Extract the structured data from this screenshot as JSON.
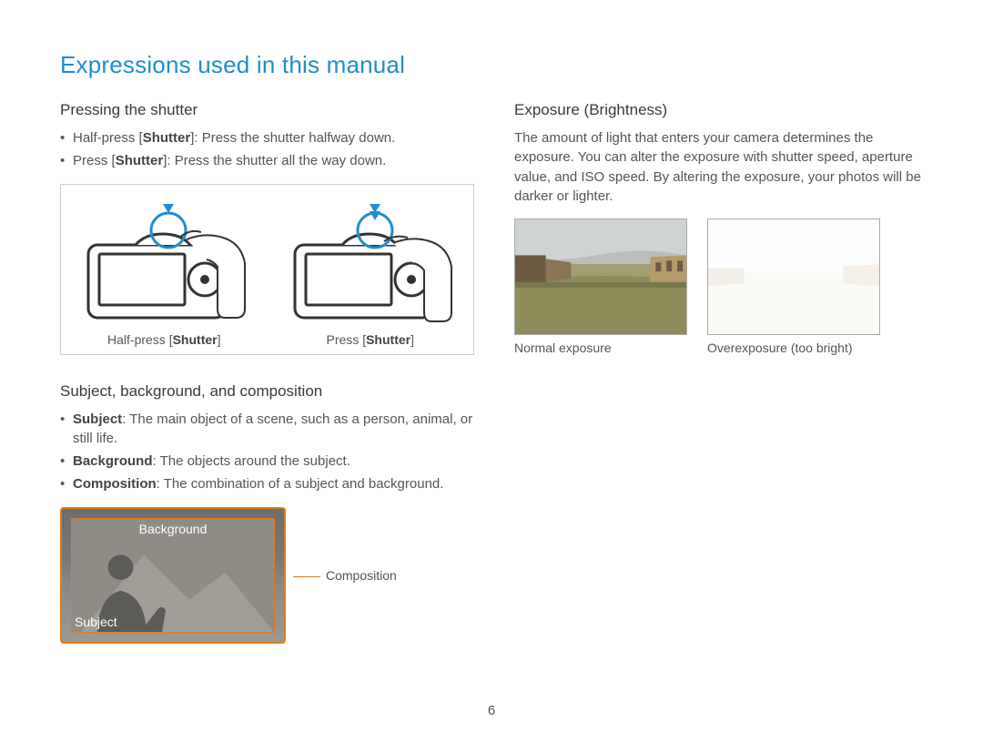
{
  "page_title": "Expressions used in this manual",
  "page_number": "6",
  "left": {
    "pressing": {
      "heading": "Pressing the shutter",
      "bullets": [
        {
          "prefix": "Half-press [",
          "bold": "Shutter",
          "suffix": "]: Press the shutter halfway down."
        },
        {
          "prefix": "Press [",
          "bold": "Shutter",
          "suffix": "]: Press the shutter all the way down."
        }
      ],
      "fig_half_prefix": "Half-press [",
      "fig_half_bold": "Shutter",
      "fig_half_suffix": "]",
      "fig_full_prefix": "Press [",
      "fig_full_bold": "Shutter",
      "fig_full_suffix": "]"
    },
    "sbc": {
      "heading": "Subject, background, and composition",
      "bullets": [
        {
          "bold": "Subject",
          "text": ": The main object of a scene, such as a person, animal, or still life."
        },
        {
          "bold": "Background",
          "text": ": The objects around the subject."
        },
        {
          "bold": "Composition",
          "text": ": The combination of a subject and background."
        }
      ],
      "label_background": "Background",
      "label_subject": "Subject",
      "label_composition": "Composition"
    }
  },
  "right": {
    "exposure": {
      "heading": "Exposure (Brightness)",
      "body": "The amount of light that enters your camera determines the exposure. You can alter the exposure with shutter speed, aperture value, and ISO speed. By altering the exposure, your photos will be darker or lighter.",
      "cap_normal": "Normal exposure",
      "cap_over": "Overexposure (too bright)"
    }
  },
  "icons": {
    "down_arrow": "▼",
    "finger_circle": "○"
  }
}
